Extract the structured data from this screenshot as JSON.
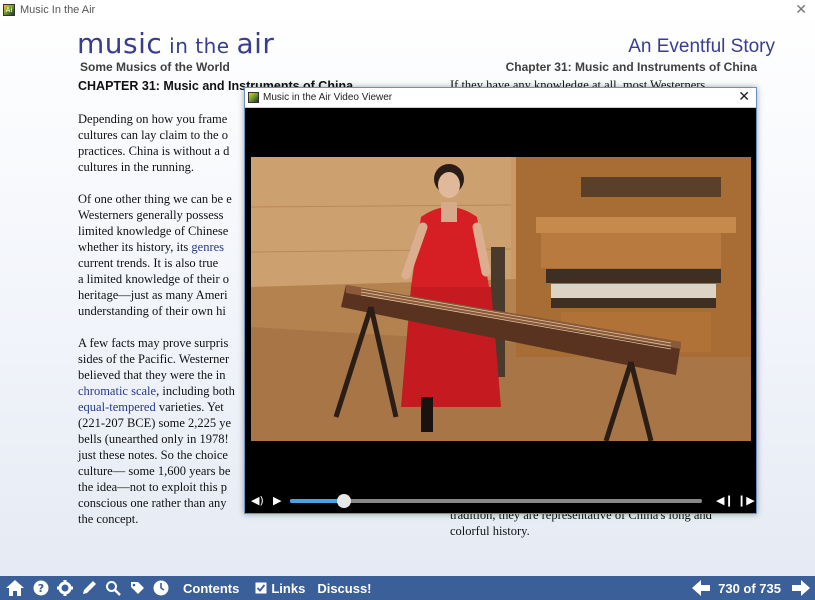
{
  "window": {
    "title": "Music In the Air",
    "app_icon_text": "Ai"
  },
  "header": {
    "logo_big": "music",
    "logo_small": " in the ",
    "logo_end": "air",
    "subtitle_left": "Some Musics of the World",
    "title_right": "An Eventful Story",
    "subtitle_right": "Chapter 31: Music and Instruments of China"
  },
  "left_column": {
    "heading": "CHAPTER 31: Music and Instruments of China",
    "p1": "Depending on how you frame",
    "p1_l2": "cultures can lay claim to the o",
    "p1_l3": "practices. China is without a d",
    "p1_l4": "cultures in the running.",
    "p2_l1": "Of one other thing we can be e",
    "p2_l2": "Westerners generally possess",
    "p2_l3": "limited knowledge of Chinese",
    "p2_l4a": "whether its history, its ",
    "p2_l4link": "genres",
    "p2_l5": "current trends. It is also true",
    "p2_l6": "a limited knowledge of their o",
    "p2_l7": "heritage—just as many Ameri",
    "p2_l8": "understanding of their own hi",
    "p3_l1": "A few facts may prove surpris",
    "p3_l2": "sides of the Pacific. Westerner",
    "p3_l3": "believed that they were the in",
    "p3_l4link": "chromatic scale",
    "p3_l4b": ", including both",
    "p3_l5link": "equal-tempered",
    "p3_l5b": " varieties. Yet",
    "p3_l6": "(221-207 BCE) some 2,225 ye",
    "p3_l7": "bells (unearthed only in 1978!",
    "p3_l8": "just these notes. So the choice",
    "p3_l9": "culture— some 1,600 years be",
    "p3_l10": "the idea—not to exploit this p",
    "p3_l11": "conscious one rather than any",
    "p3_l12": "the concept."
  },
  "right_column": {
    "top_line": "If they have any knowledge at all, most Westerners",
    "bottom_l1": "tradition, they are representative of China's long and",
    "bottom_l2": "colorful history."
  },
  "viewer": {
    "title": "Music in the Air Video Viewer",
    "progress_percent": 13
  },
  "toolbar": {
    "contents": "Contents",
    "links": "Links",
    "discuss": "Discuss!",
    "page_indicator": "730 of 735"
  },
  "colors": {
    "toolbar_bg": "#3b5f99",
    "logo": "#3a3d8f",
    "link": "#283a8c",
    "progress": "#4aa3df"
  }
}
